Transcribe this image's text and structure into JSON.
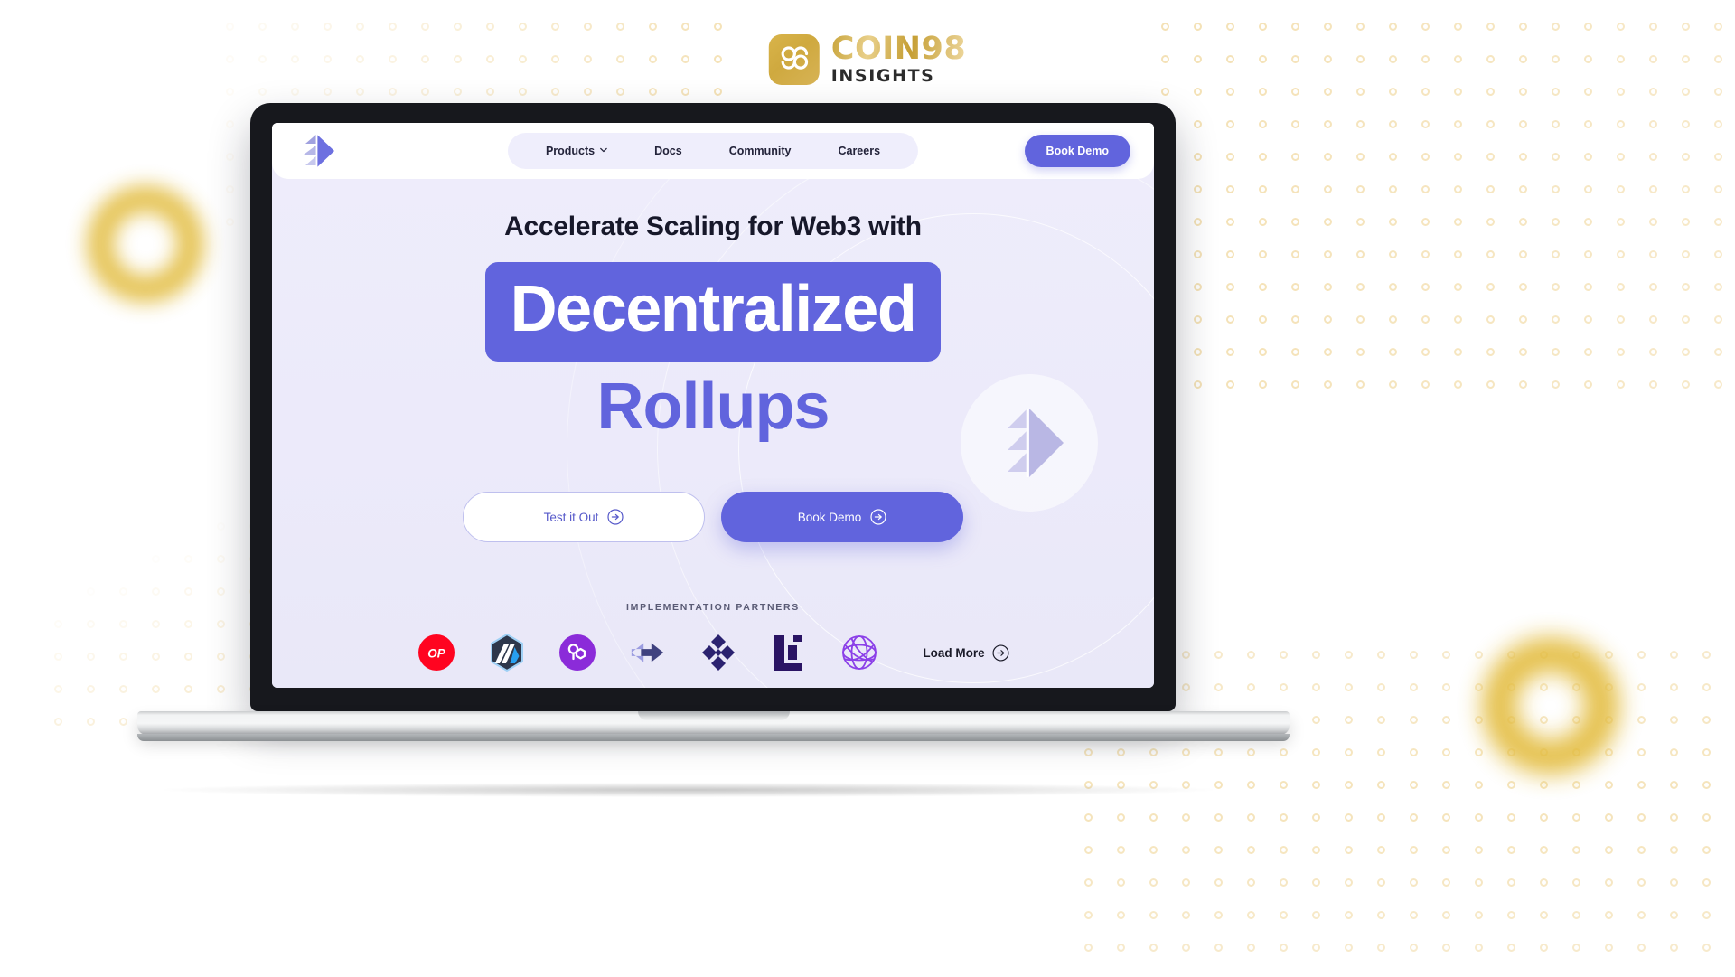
{
  "brand": {
    "mark_icon": "coin98-logo-icon",
    "name_top": "COIN98",
    "name_sub": "INSIGHTS"
  },
  "device": {
    "type": "laptop-mockup",
    "notch_name": "trackpad-notch"
  },
  "site": {
    "header": {
      "logo_icon": "rollup-diamond-logo-icon",
      "nav": [
        {
          "label": "Products",
          "has_dropdown": true,
          "icon": "chevron-down-icon"
        },
        {
          "label": "Docs",
          "has_dropdown": false
        },
        {
          "label": "Community",
          "has_dropdown": false
        },
        {
          "label": "Careers",
          "has_dropdown": false
        }
      ],
      "cta_label": "Book Demo"
    },
    "hero": {
      "eyebrow": "Accelerate Scaling for Web3 with",
      "headline_highlight": "Decentralized",
      "headline_second": "Rollups",
      "watermark_icon": "rollup-diamond-watermark-icon",
      "buttons": [
        {
          "label": "Test it Out",
          "style": "ghost",
          "icon": "arrow-right-circle-icon"
        },
        {
          "label": "Book Demo",
          "style": "solid",
          "icon": "arrow-right-circle-icon"
        }
      ]
    },
    "partners": {
      "label": "IMPLEMENTATION PARTNERS",
      "logos": [
        {
          "name": "optimism-logo-icon",
          "text": "OP",
          "color": "#ff0420"
        },
        {
          "name": "arbitrum-logo-icon",
          "color": "#1b4add"
        },
        {
          "name": "polygon-logo-icon",
          "color": "#8b2bd9"
        },
        {
          "name": "connext-arrows-logo-icon",
          "color": "#3c3e8c"
        },
        {
          "name": "diamond-cluster-logo-icon",
          "color": "#2b2270"
        },
        {
          "name": "blocks-l-logo-icon",
          "color": "#2a1464"
        },
        {
          "name": "globe-mesh-logo-icon",
          "color": "#8b3fe8"
        }
      ],
      "load_more_label": "Load More",
      "load_more_icon": "arrow-right-circle-icon"
    }
  },
  "theme": {
    "accent_purple": "#6164dd",
    "hero_bg": "#eeedfb",
    "gold": "#e3be45",
    "dot_gold": "#f0d69a",
    "text_dark": "#17182a"
  }
}
